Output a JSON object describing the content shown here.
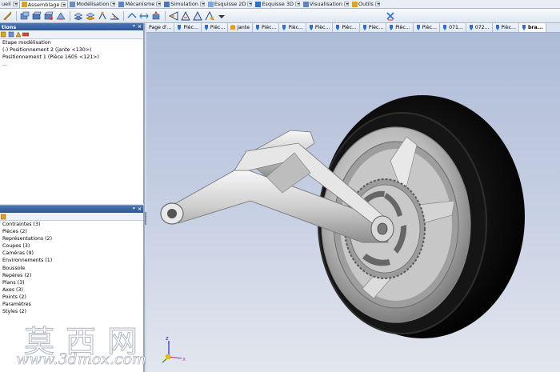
{
  "ribbon": {
    "tabs": [
      {
        "label": "ueil",
        "active": false
      },
      {
        "label": "Assemblage",
        "active": true
      },
      {
        "label": "Modélisation",
        "active": false
      },
      {
        "label": "Mécanisme",
        "active": false
      },
      {
        "label": "Simulation",
        "active": false
      },
      {
        "label": "Esquisse 2D",
        "active": false
      },
      {
        "label": "Esquisse 3D",
        "active": false
      },
      {
        "label": "Visualisation",
        "active": false
      },
      {
        "label": "Outils",
        "active": false
      }
    ]
  },
  "panel_top": {
    "title": "tions",
    "items": [
      "Etape modélisation",
      "(-) Positionnement 2 (jante <130>)",
      "Positionnement 1 (Pièce 1605 <121>)",
      "..."
    ]
  },
  "panel_bottom": {
    "title": "",
    "items": [
      "Contraintes (3)",
      "Pièces (2)",
      "Représentations (2)",
      "Coupes (3)",
      "Caméras (9)",
      "Environnements (1)",
      "Boussole",
      "Repères (2)",
      "Plans (3)",
      "Axes (3)",
      "Points (2)",
      "Paramètres",
      "Styles (2)"
    ]
  },
  "doc_tabs": [
    {
      "label": "Page d'...",
      "active": false
    },
    {
      "label": "Pièc...",
      "active": false
    },
    {
      "label": "Pièc...",
      "active": false
    },
    {
      "label": "jante",
      "active": false
    },
    {
      "label": "Pièc...",
      "active": false
    },
    {
      "label": "Pièc...",
      "active": false
    },
    {
      "label": "Pièc...",
      "active": false
    },
    {
      "label": "Pièc...",
      "active": false
    },
    {
      "label": "Pièc...",
      "active": false
    },
    {
      "label": "Pièc...",
      "active": false
    },
    {
      "label": "Pièc...",
      "active": false
    },
    {
      "label": "071...",
      "active": false
    },
    {
      "label": "072...",
      "active": false
    },
    {
      "label": "Pièc...",
      "active": false
    },
    {
      "label": "bra...",
      "active": true
    }
  ],
  "watermark": {
    "chinese": "莫西网",
    "url": "www.3dmox.com"
  },
  "triad": {
    "x": "x",
    "y": "y",
    "z": "z"
  },
  "colors": {
    "title_bar": "#2d5693",
    "tire": "#0b0b0b",
    "rim": "#c9c9c9",
    "arm": "#dcdcdc"
  }
}
